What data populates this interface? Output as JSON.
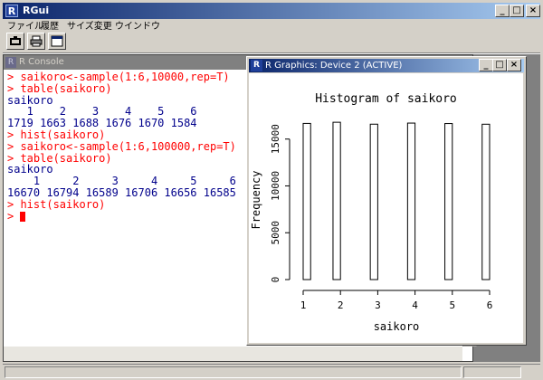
{
  "app": {
    "title": "RGui"
  },
  "menu": [
    "ファイル",
    "履歴",
    "サイズ変更",
    "ウインドウ"
  ],
  "toolbar": {
    "icons": [
      "open-script-icon",
      "print-icon",
      "console-icon"
    ]
  },
  "window_buttons": {
    "minimize": "_",
    "maximize": "□",
    "close": "×"
  },
  "console": {
    "title": "R Console",
    "lines": [
      {
        "type": "in",
        "text": "> saikoro<-sample(1:6,10000,rep=T)"
      },
      {
        "type": "in",
        "text": "> table(saikoro)"
      },
      {
        "type": "out",
        "text": "saikoro"
      },
      {
        "type": "out",
        "text": "   1    2    3    4    5    6"
      },
      {
        "type": "out",
        "text": "1719 1663 1688 1676 1670 1584"
      },
      {
        "type": "in",
        "text": "> hist(saikoro)"
      },
      {
        "type": "in",
        "text": "> saikoro<-sample(1:6,100000,rep=T)"
      },
      {
        "type": "in",
        "text": "> table(saikoro)"
      },
      {
        "type": "out",
        "text": "saikoro"
      },
      {
        "type": "out",
        "text": "    1     2     3     4     5     6"
      },
      {
        "type": "out",
        "text": "16670 16794 16589 16706 16656 16585"
      },
      {
        "type": "in",
        "text": "> hist(saikoro)"
      },
      {
        "type": "in",
        "text": "> "
      }
    ]
  },
  "graphics": {
    "title": "R Graphics: Device 2 (ACTIVE)"
  },
  "chart_data": {
    "type": "bar",
    "title": "Histogram of saikoro",
    "xlabel": "saikoro",
    "ylabel": "Frequency",
    "bins": [
      {
        "from": 1.0,
        "to": 1.2,
        "value": 16670
      },
      {
        "from": 1.8,
        "to": 2.0,
        "value": 16794
      },
      {
        "from": 2.8,
        "to": 3.0,
        "value": 16589
      },
      {
        "from": 3.8,
        "to": 4.0,
        "value": 16706
      },
      {
        "from": 4.8,
        "to": 5.0,
        "value": 16656
      },
      {
        "from": 5.8,
        "to": 6.0,
        "value": 16585
      }
    ],
    "xticks": [
      "1",
      "2",
      "3",
      "4",
      "5",
      "6"
    ],
    "yticks": [
      "0",
      "5000",
      "10000",
      "15000"
    ],
    "xlim": [
      1,
      6
    ],
    "ylim": [
      0,
      15000
    ]
  }
}
